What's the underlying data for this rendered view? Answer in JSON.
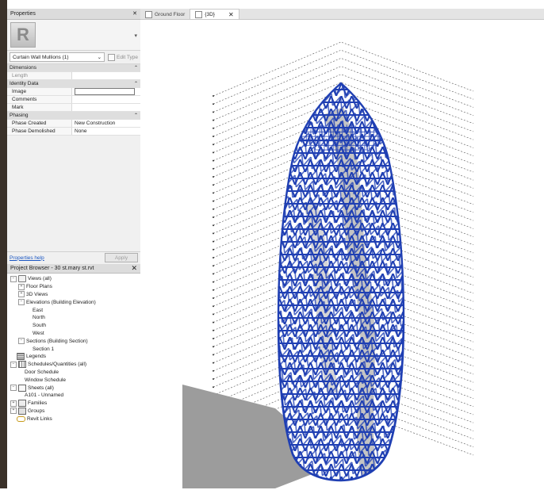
{
  "properties": {
    "title": "Properties",
    "type_selector": "Curtain Wall Mullions (1)",
    "edit_type_label": "Edit Type",
    "categories": [
      {
        "name": "Dimensions",
        "rows": [
          {
            "name": "Length",
            "value": "",
            "greyed": true
          }
        ]
      },
      {
        "name": "Identity Data",
        "rows": [
          {
            "name": "Image",
            "value": ""
          },
          {
            "name": "Comments",
            "value": ""
          },
          {
            "name": "Mark",
            "value": ""
          }
        ]
      },
      {
        "name": "Phasing",
        "rows": [
          {
            "name": "Phase Created",
            "value": "New Construction"
          },
          {
            "name": "Phase Demolished",
            "value": "None"
          }
        ]
      }
    ],
    "help_link": "Properties help",
    "apply_label": "Apply"
  },
  "project_browser": {
    "title": "Project Browser - 30 st.mary st.rvt",
    "items": [
      {
        "label": "Views (all)",
        "level": 0,
        "expander": "-",
        "icon": "views"
      },
      {
        "label": "Floor Plans",
        "level": 1,
        "expander": "+"
      },
      {
        "label": "3D Views",
        "level": 1,
        "expander": "+"
      },
      {
        "label": "Elevations (Building Elevation)",
        "level": 1,
        "expander": "-"
      },
      {
        "label": "East",
        "level": 2
      },
      {
        "label": "North",
        "level": 2
      },
      {
        "label": "South",
        "level": 2
      },
      {
        "label": "West",
        "level": 2
      },
      {
        "label": "Sections (Building Section)",
        "level": 1,
        "expander": "-"
      },
      {
        "label": "Section 1",
        "level": 2
      },
      {
        "label": "Legends",
        "level": 0,
        "icon": "legend"
      },
      {
        "label": "Schedules/Quantities (all)",
        "level": 0,
        "expander": "-",
        "icon": "sched"
      },
      {
        "label": "Door Schedule",
        "level": 1
      },
      {
        "label": "Window Schedule",
        "level": 1
      },
      {
        "label": "Sheets (all)",
        "level": 0,
        "expander": "-",
        "icon": "sheet"
      },
      {
        "label": "A101 - Unnamed",
        "level": 1
      },
      {
        "label": "Families",
        "level": 0,
        "expander": "+",
        "icon": "fam"
      },
      {
        "label": "Groups",
        "level": 0,
        "expander": "+",
        "icon": "grp"
      },
      {
        "label": "Revit Links",
        "level": 0,
        "icon": "link"
      }
    ]
  },
  "tabs": [
    {
      "label": "Ground Floor",
      "active": false
    },
    {
      "label": "{3D}",
      "active": true
    }
  ],
  "view": {
    "mesh_color": "#1f3fb3",
    "shadow_color": "#9c9c9c",
    "core_color": "#c4c4c4"
  }
}
